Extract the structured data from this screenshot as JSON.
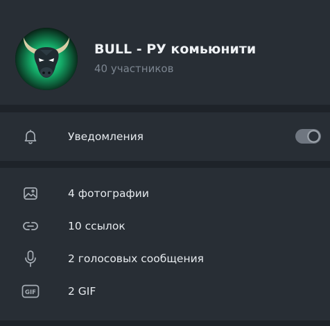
{
  "chat": {
    "title": "BULL - РУ комьюнити",
    "members": "40 участников"
  },
  "notifications": {
    "label": "Уведомления",
    "enabled": true,
    "icon": "bell-icon"
  },
  "media": [
    {
      "label": "4 фотографии",
      "icon": "photo-icon"
    },
    {
      "label": "10 ссылок",
      "icon": "link-icon"
    },
    {
      "label": "2 голосовых сообщения",
      "icon": "microphone-icon"
    },
    {
      "label": "2 GIF",
      "icon": "gif-icon"
    }
  ],
  "colors": {
    "background": "#1e2329",
    "panel": "#282e35",
    "text": "#e6eaee",
    "secondary_text": "#7c8590",
    "avatar_glow": "#1fd08a"
  }
}
